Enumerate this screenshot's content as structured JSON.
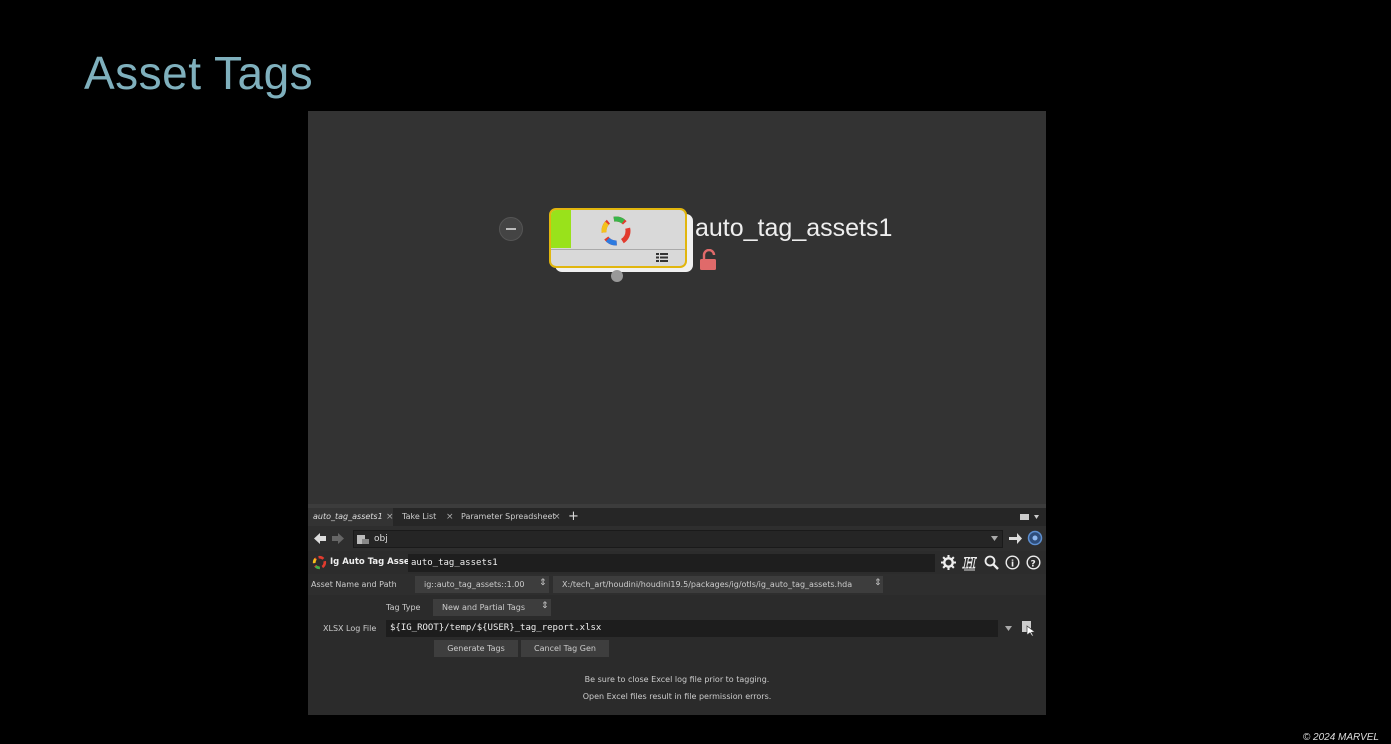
{
  "slide": {
    "title": "Asset Tags",
    "copyright": "© 2024 MARVEL"
  },
  "network": {
    "node_label": "auto_tag_assets1"
  },
  "tabs": [
    {
      "label": "auto_tag_assets1"
    },
    {
      "label": "Take List"
    },
    {
      "label": "Parameter Spreadsheet"
    }
  ],
  "path_bar": {
    "path": "obj"
  },
  "param_header": {
    "node_type": "Ig Auto Tag Assets",
    "node_name": "auto_tag_assets1"
  },
  "asset_row": {
    "label": "Asset Name and Path",
    "asset_name": "ig::auto_tag_assets::1.00",
    "asset_path": "X:/tech_art/houdini/houdini19.5/packages/ig/otls/ig_auto_tag_assets.hda"
  },
  "params": {
    "tag_type_label": "Tag Type",
    "tag_type_value": "New and Partial Tags",
    "xlsx_label": "XLSX Log File",
    "xlsx_value": "${IG_ROOT}/temp/${USER}_tag_report.xlsx",
    "generate_label": "Generate Tags",
    "cancel_label": "Cancel Tag Gen",
    "note_line1": "Be sure to close Excel log file prior to tagging.",
    "note_line2": "Open Excel files result in file permission errors."
  }
}
